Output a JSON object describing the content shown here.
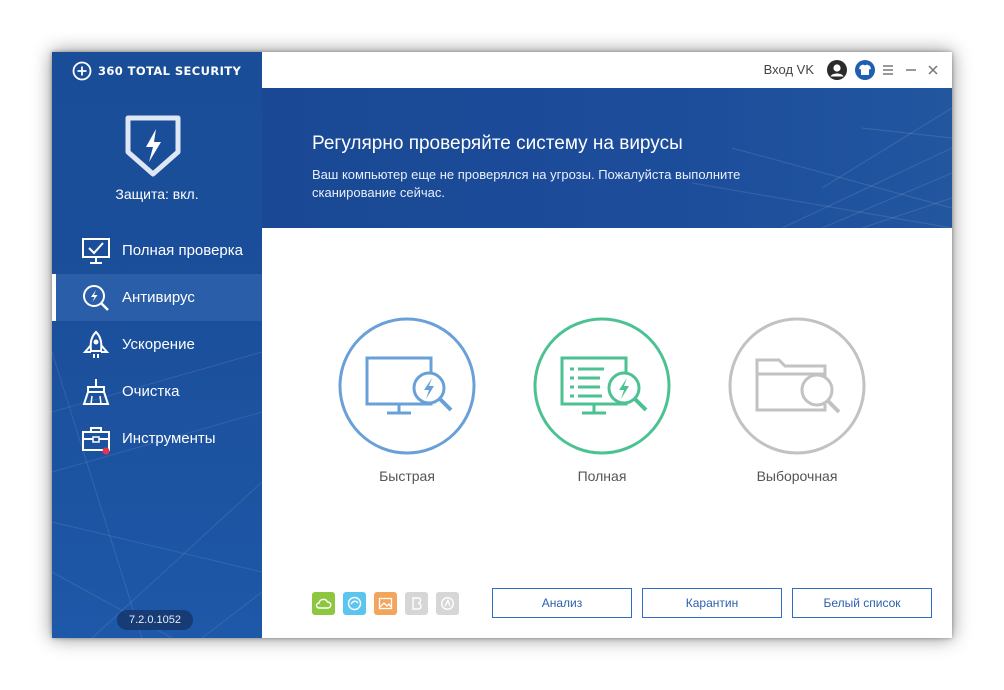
{
  "app": {
    "brand_text": "360 TOTAL SECURITY",
    "accent": "#1b4f9b"
  },
  "status": {
    "protection_label": "Защита: вкл."
  },
  "sidebar": {
    "items": [
      {
        "label": "Полная проверка",
        "icon": "monitor-check-icon",
        "active": false
      },
      {
        "label": "Антивирус",
        "icon": "antivirus-magnifier-icon",
        "active": true
      },
      {
        "label": "Ускорение",
        "icon": "rocket-icon",
        "active": false
      },
      {
        "label": "Очистка",
        "icon": "broom-icon",
        "active": false
      },
      {
        "label": "Инструменты",
        "icon": "toolbox-icon",
        "active": false
      }
    ],
    "version": "7.2.0.1052"
  },
  "titlebar": {
    "login_label": "Вход VK"
  },
  "banner": {
    "title": "Регулярно проверяйте систему на вирусы",
    "subtitle": "Ваш компьютер еще не проверялся на угрозы. Пожалуйста выполните сканирование сейчас."
  },
  "scan_options": [
    {
      "label": "Быстрая",
      "color": "#6aa0d8"
    },
    {
      "label": "Полная",
      "color": "#4cc293"
    },
    {
      "label": "Выборочная",
      "color": "#c2c2c2"
    }
  ],
  "engines": [
    {
      "name": "cloud-engine-icon",
      "color": "#8dc63f"
    },
    {
      "name": "qvm-engine-icon",
      "color": "#5bc4ef"
    },
    {
      "name": "image-engine-icon",
      "color": "#f3a45d"
    },
    {
      "name": "bitdefender-engine-icon",
      "color": "#d6d6d6"
    },
    {
      "name": "avira-engine-icon",
      "color": "#d6d6d6"
    }
  ],
  "buttons": {
    "analysis": "Анализ",
    "quarantine": "Карантин",
    "whitelist": "Белый список"
  }
}
